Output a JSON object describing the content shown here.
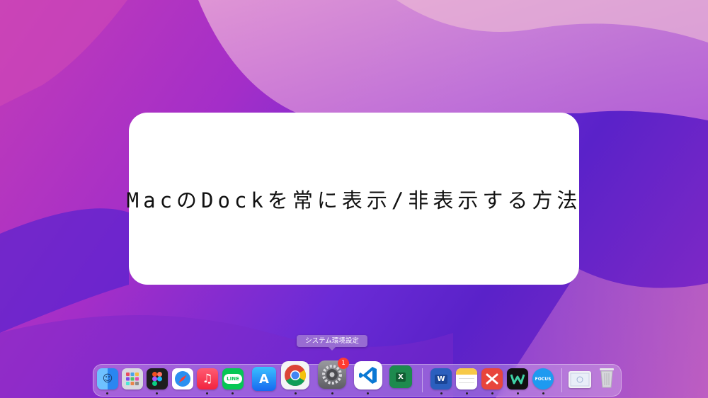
{
  "article": {
    "title": "MacのDockを常に表示/非表示する方法"
  },
  "tooltip": {
    "label": "システム環境設定"
  },
  "dock": {
    "apps": [
      {
        "name": "Finder",
        "icon": "finder-icon"
      },
      {
        "name": "Launchpad",
        "icon": "launchpad-icon"
      },
      {
        "name": "Figma",
        "icon": "figma-icon"
      },
      {
        "name": "Safari",
        "icon": "safari-icon"
      },
      {
        "name": "Music",
        "icon": "music-icon"
      },
      {
        "name": "LINE",
        "icon": "line-icon",
        "label": "LINE"
      },
      {
        "name": "App Store",
        "icon": "app-store-icon"
      },
      {
        "name": "Google Chrome",
        "icon": "chrome-icon"
      },
      {
        "name": "System Preferences",
        "icon": "gear-icon",
        "badge": "1"
      },
      {
        "name": "Visual Studio Code",
        "icon": "vscode-icon"
      },
      {
        "name": "Excel",
        "icon": "excel-icon",
        "label": "X"
      },
      {
        "name": "Word",
        "icon": "word-icon",
        "label": "W"
      },
      {
        "name": "Notes",
        "icon": "notes-icon"
      },
      {
        "name": "Xmind",
        "icon": "xmind-icon"
      },
      {
        "name": "Webex",
        "icon": "webex-icon"
      },
      {
        "name": "Focus",
        "icon": "focus-icon",
        "label": "FOCUS"
      },
      {
        "name": "Downloads",
        "icon": "downloads-folder-icon"
      },
      {
        "name": "Trash",
        "icon": "trash-icon"
      }
    ]
  },
  "colors": {
    "wallpaper_pink": "#c23cb8",
    "wallpaper_purple": "#5a22c9",
    "badge_red": "#ff3b30"
  }
}
